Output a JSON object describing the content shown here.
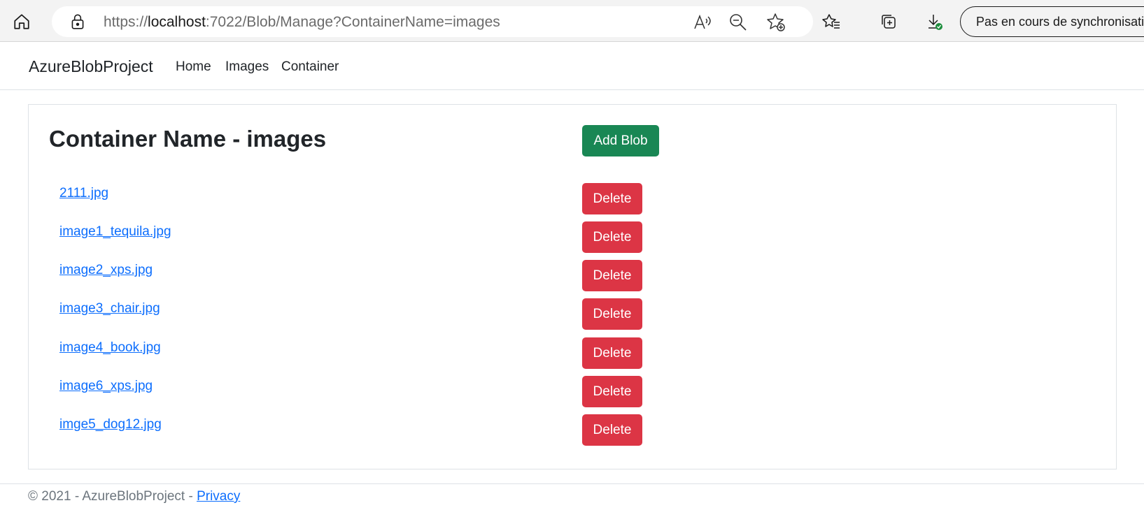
{
  "browser": {
    "url_prefix": "https://",
    "url_host": "localhost",
    "url_rest": ":7022/Blob/Manage?ContainerName=images",
    "sync_label": "Pas en cours de synchronisation",
    "icons": [
      "home-icon",
      "lock-icon",
      "read-aloud-icon",
      "zoom-out-icon",
      "add-favorite-icon",
      "favorites-icon",
      "collections-icon",
      "downloads-icon"
    ]
  },
  "navbar": {
    "brand": "AzureBlobProject",
    "links": [
      "Home",
      "Images",
      "Container"
    ]
  },
  "main": {
    "title": "Container Name - images",
    "add_button": "Add Blob",
    "delete_label": "Delete",
    "blobs": [
      "2111.jpg",
      "image1_tequila.jpg",
      "image2_xps.jpg",
      "image3_chair.jpg",
      "image4_book.jpg",
      "image6_xps.jpg",
      "imge5_dog12.jpg"
    ]
  },
  "footer": {
    "text": "© 2021 - AzureBlobProject - ",
    "privacy": "Privacy"
  },
  "colors": {
    "success": "#198754",
    "danger": "#dc3545",
    "link": "#0d6efd"
  }
}
